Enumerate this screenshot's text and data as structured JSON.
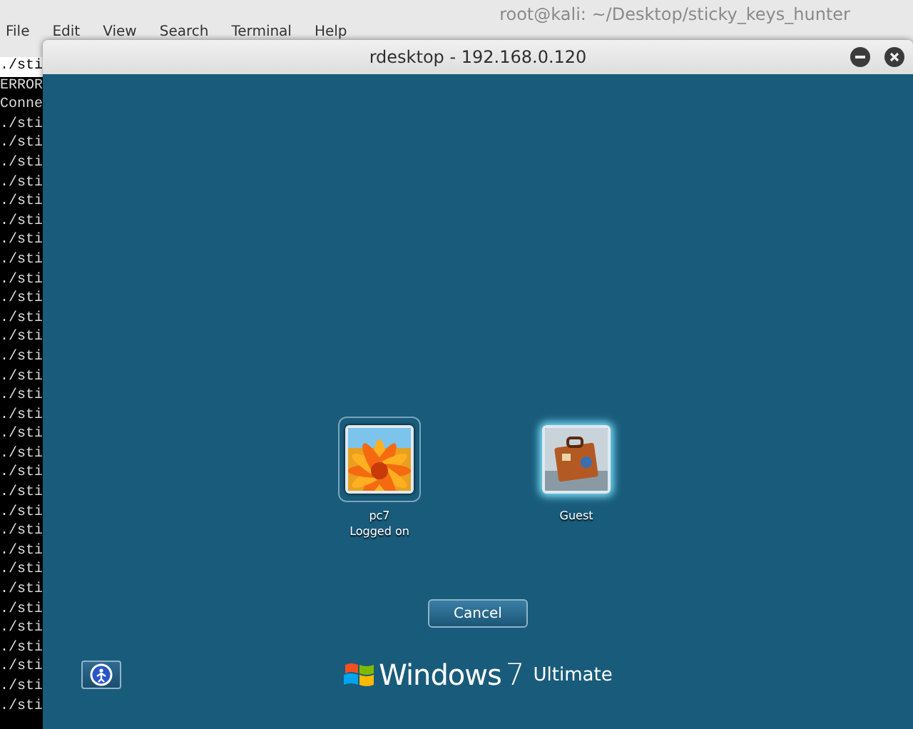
{
  "terminal": {
    "title": "root@kali: ~/Desktop/sticky_keys_hunter",
    "menu": [
      "File",
      "Edit",
      "View",
      "Search",
      "Terminal",
      "Help"
    ],
    "lines": [
      "./sti",
      "ERROR",
      "Conne",
      "./sti",
      "./sti",
      "./sti",
      "./sti",
      "./sti",
      "./sti",
      "./sti",
      "./sti",
      "./sti",
      "./sti",
      "./sti",
      "./sti",
      "./sti",
      "./sti",
      "./sti",
      "./sti",
      "./sti",
      "./sti",
      "./sti",
      "./sti",
      "./sti",
      "./sti",
      "./sti",
      "./sti",
      "./sti",
      "./sti",
      "./sti",
      "./sti",
      "./sti",
      "./sti",
      "./sti"
    ]
  },
  "rdesktop": {
    "title": "rdesktop - 192.168.0.120",
    "users": [
      {
        "name": "pc7",
        "status": "Logged on",
        "selected": true,
        "focused": false
      },
      {
        "name": "Guest",
        "selected": false,
        "focused": true
      }
    ],
    "cancel_button": "Cancel",
    "brand": {
      "name": "Windows",
      "version": "7",
      "edition": "Ultimate"
    }
  }
}
